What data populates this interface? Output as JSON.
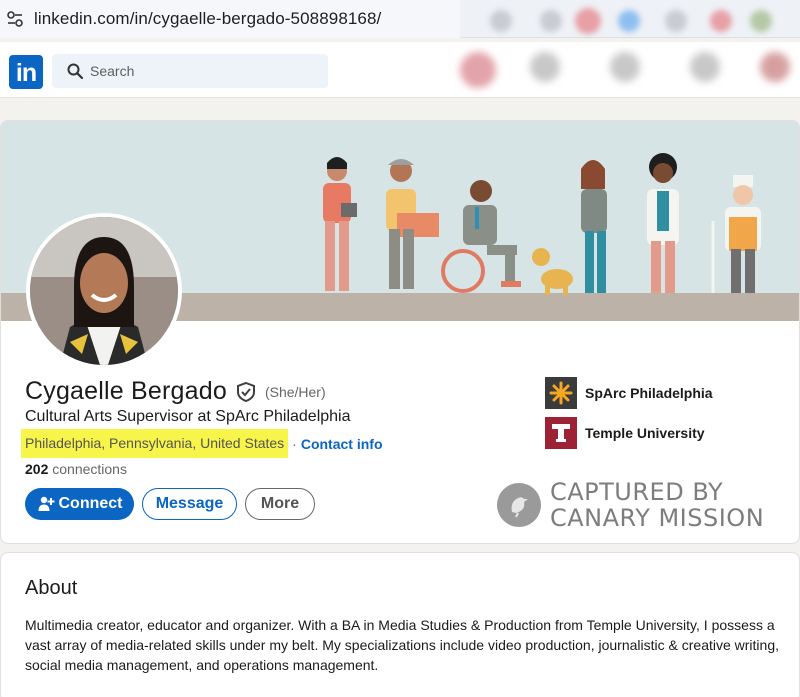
{
  "browser": {
    "url": "linkedin.com/in/cygaelle-bergado-508898168/"
  },
  "nav": {
    "logo_text": "in",
    "search_placeholder": "Search"
  },
  "profile": {
    "name": "Cygaelle Bergado",
    "pronouns": "(She/Her)",
    "headline": "Cultural Arts Supervisor at SpArc Philadelphia",
    "location": "Philadelphia, Pennsylvania, United States",
    "separator": "·",
    "contact_label": "Contact info",
    "connections_count": "202",
    "connections_label": "connections",
    "buttons": {
      "connect": "Connect",
      "message": "Message",
      "more": "More"
    },
    "organizations": [
      {
        "name": "SpArc Philadelphia",
        "logo_color": "#f5a623"
      },
      {
        "name": "Temple University",
        "logo_color": "#9d2235"
      }
    ]
  },
  "watermark": {
    "line1": "CAPTURED BY",
    "line2": "CANARY MISSION"
  },
  "about": {
    "title": "About",
    "text": "Multimedia creator, educator and organizer. With a BA in Media Studies & Production from Temple University, I possess a vast array of media-related skills under my belt. My specializations include video production, journalistic & creative writing, social media management, and operations management."
  },
  "colors": {
    "brand": "#0a66c2",
    "highlight": "#f7f44a",
    "banner": "#d6e4e6"
  }
}
